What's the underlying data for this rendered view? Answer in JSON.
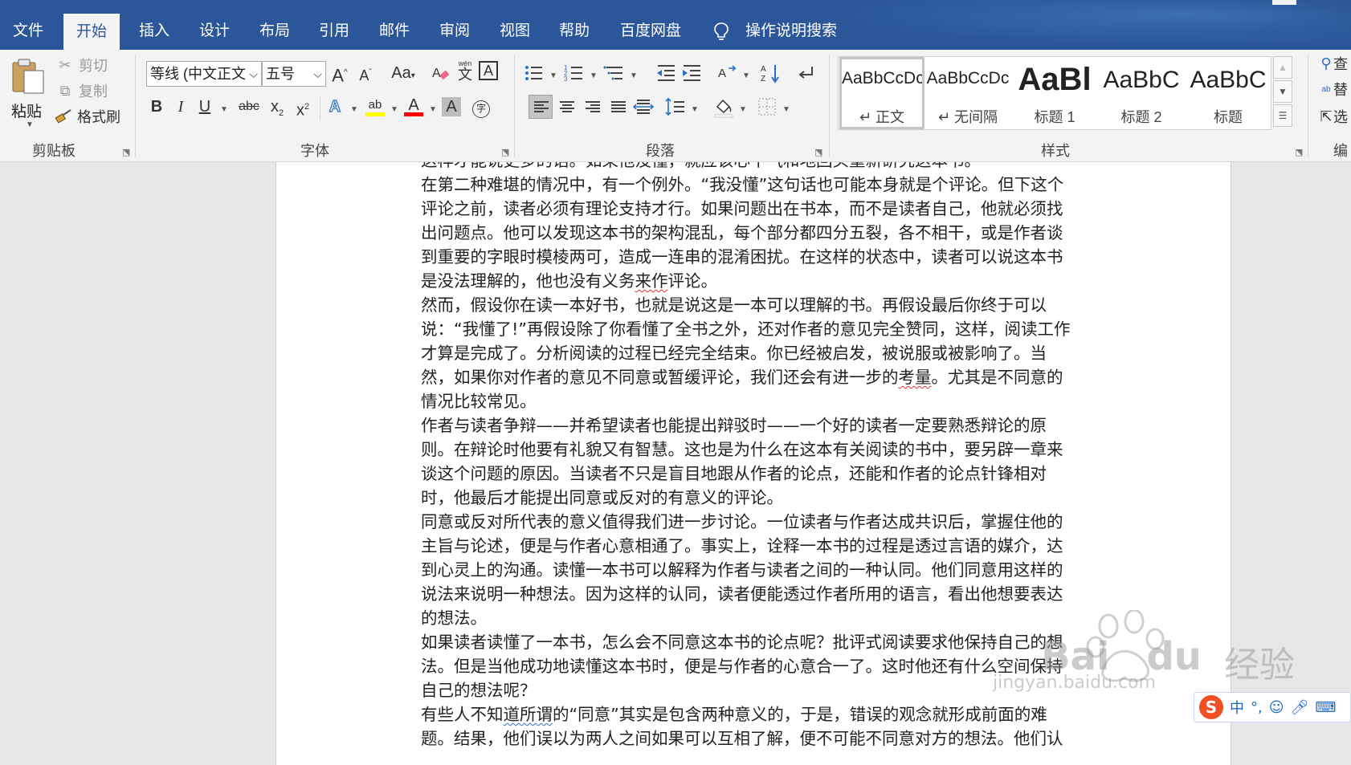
{
  "tabs": [
    "文件",
    "开始",
    "插入",
    "设计",
    "布局",
    "引用",
    "邮件",
    "审阅",
    "视图",
    "帮助",
    "百度网盘"
  ],
  "active_tab": "开始",
  "tell_me": "操作说明搜索",
  "clipboard": {
    "paste": "粘贴",
    "cut": "剪切",
    "copy": "复制",
    "format_painter": "格式刷",
    "group_label": "剪贴板"
  },
  "font": {
    "name": "等线 (中文正文",
    "size": "五号",
    "grow": "A",
    "shrink": "A",
    "change_case": "Aa",
    "phonetic": "wén",
    "phonetic_char": "文",
    "border_char": "A",
    "bold": "B",
    "italic": "I",
    "underline": "U",
    "strike": "abc",
    "subscript": "x",
    "sub_mark": "2",
    "superscript": "x",
    "sup_mark": "2",
    "effects": "A",
    "highlight": "ab",
    "font_color": "A",
    "shading": "A",
    "enclose": "字",
    "group_label": "字体",
    "highlight_color": "#ffff00",
    "font_color_value": "#ff0000"
  },
  "paragraph": {
    "group_label": "段落"
  },
  "styles": {
    "group_label": "样式",
    "items": [
      {
        "preview": "AaBbCcDc",
        "name": "↵ 正文"
      },
      {
        "preview": "AaBbCcDc",
        "name": "↵ 无间隔"
      },
      {
        "preview": "AaBl",
        "name": "标题 1"
      },
      {
        "preview": "AaBbC",
        "name": "标题 2"
      },
      {
        "preview": "AaBbC",
        "name": "标题"
      }
    ]
  },
  "editing": {
    "find": "查",
    "replace": "替",
    "select": "选",
    "group_label": "编"
  },
  "document": {
    "lines": [
      "这样才能说更多的话。如果他没懂，就应该心平气和地回头重新研究这本书。",
      "在第二种难堪的情况中，有一个例外。“我没懂”这句话也可能本身就是个评论。但下这个",
      "评论之前，读者必须有理论支持才行。如果问题出在书本，而不是读者自己，他就必须找",
      "出问题点。他可以发现这本书的架构混乱，每个部分都四分五裂，各不相干，或是作者谈",
      "到重要的字眼时模棱两可，造成一连串的混淆困扰。在这样的状态中，读者可以说这本书",
      "是没法理解的，他也没有义务来作评论。",
      "然而，假设你在读一本好书，也就是说这是一本可以理解的书。再假设最后你终于可以",
      "说：“我懂了!”再假设除了你看懂了全书之外，还对作者的意见完全赞同，这样，阅读工作",
      "才算是完成了。分析阅读的过程已经完全结束。你已经被启发，被说服或被影响了。当",
      "然，如果你对作者的意见不同意或暂缓评论，我们还会有进一步的考量。尤其是不同意的",
      "情况比较常见。",
      "作者与读者争辩——并希望读者也能提出辩驳时——一个好的读者一定要熟悉辩论的原",
      "则。在辩论时他要有礼貌又有智慧。这也是为什么在这本有关阅读的书中，要另辟一章来",
      "谈这个问题的原因。当读者不只是盲目地跟从作者的论点，还能和作者的论点针锋相对",
      "时，他最后才能提出同意或反对的有意义的评论。",
      "同意或反对所代表的意义值得我们进一步讨论。一位读者与作者达成共识后，掌握住他的",
      "主旨与论述，便是与作者心意相通了。事实上，诠释一本书的过程是透过言语的媒介，达",
      "到心灵上的沟通。读懂一本书可以解释为作者与读者之间的一种认同。他们同意用这样的",
      "说法来说明一种想法。因为这样的认同，读者便能透过作者所用的语言，看出他想要表达",
      "的想法。",
      "如果读者读懂了一本书，怎么会不同意这本书的论点呢？批评式阅读要求他保持自己的想",
      "法。但是当他成功地读懂这本书时，便是与作者的心意合一了。这时他还有什么空间保持",
      "自己的想法呢？",
      "有些人不知道所谓的“同意”其实是包含两种意义的，于是，错误的观念就形成前面的难",
      "题。结果，他们误以为两人之间如果可以互相了解，便不可能不同意对方的想法。他们认"
    ]
  },
  "ime": {
    "logo": "S",
    "mode": "中",
    "punct": "°,"
  },
  "watermark": {
    "brand": "Bai",
    "brand2": "du",
    "jingyan": "经验",
    "url": "jingyan.baidu.com"
  }
}
